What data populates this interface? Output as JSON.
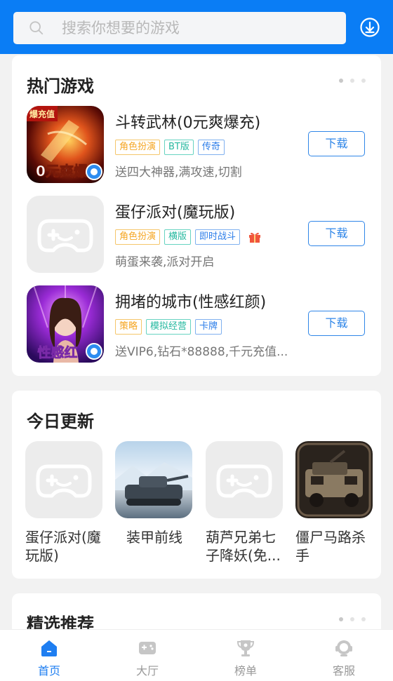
{
  "search": {
    "placeholder": "搜索你想要的游戏"
  },
  "hot": {
    "title": "热门游戏",
    "games": [
      {
        "title": "斗转武林(0元爽爆充)",
        "tags": [
          "角色扮演",
          "BT版",
          "传奇"
        ],
        "desc": "送四大神器,满攻速,切割",
        "button": "下载",
        "icon_text": "0元爽爆",
        "badge_text": "爆充值"
      },
      {
        "title": "蛋仔派对(魔玩版)",
        "tags": [
          "角色扮演",
          "横版",
          "即时战斗"
        ],
        "desc": "萌蛋来袭,派对开启",
        "button": "下载"
      },
      {
        "title": "拥堵的城市(性感红颜)",
        "tags": [
          "策略",
          "模拟经营",
          "卡牌"
        ],
        "desc": "送VIP6,钻石*88888,千元充值...",
        "button": "下载",
        "icon_text": "性感红"
      }
    ]
  },
  "today": {
    "title": "今日更新",
    "items": [
      {
        "name": "蛋仔派对(魔玩版)"
      },
      {
        "name": "装甲前线"
      },
      {
        "name": "葫芦兄弟七子降妖(免..."
      },
      {
        "name": "僵尸马路杀手"
      }
    ]
  },
  "featured": {
    "title": "精选推荐"
  },
  "nav": {
    "items": [
      {
        "label": "首页"
      },
      {
        "label": "大厅"
      },
      {
        "label": "榜单"
      },
      {
        "label": "客服"
      }
    ]
  },
  "colors": {
    "brand": "#0a7df5",
    "active_nav": "#1e7ef1",
    "button": "#2f86e8"
  }
}
